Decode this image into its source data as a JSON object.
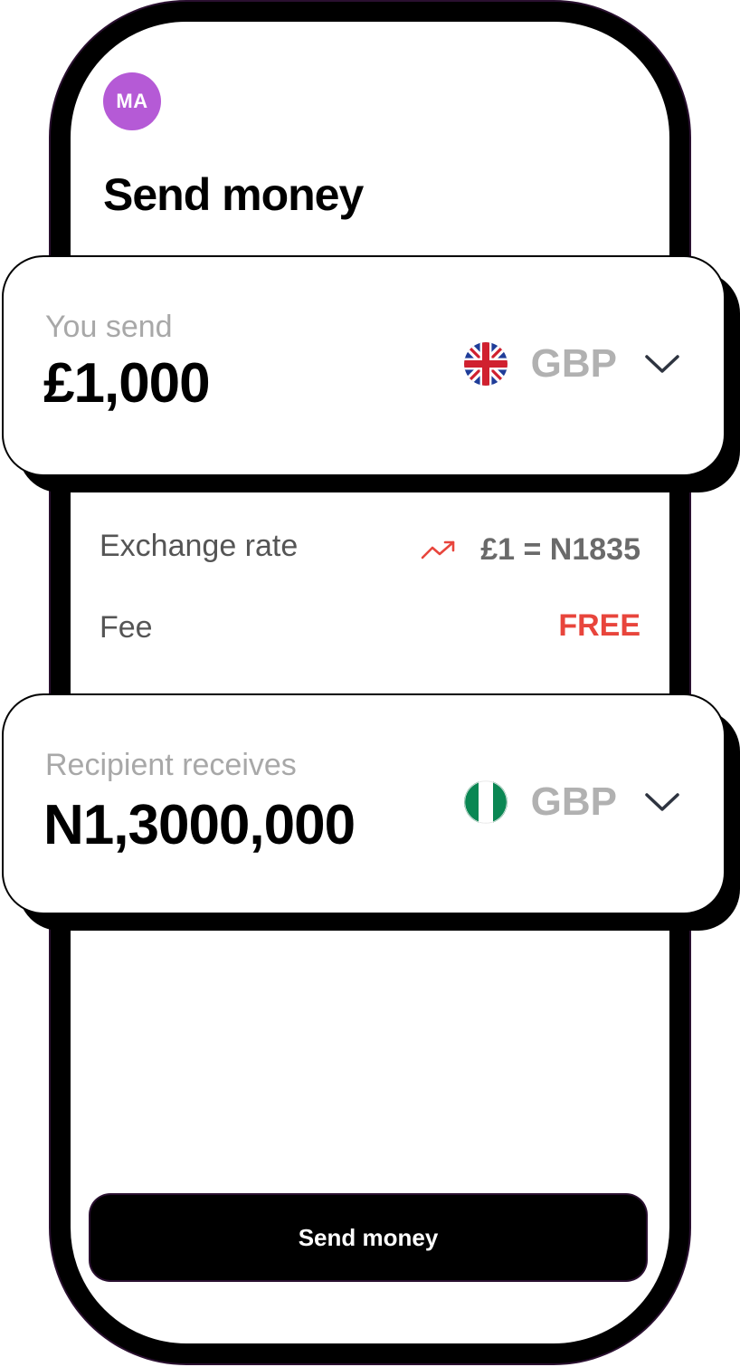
{
  "header": {
    "avatar_initials": "MA",
    "title": "Send money"
  },
  "send_card": {
    "label": "You send",
    "amount": "£1,000",
    "currency": "GBP",
    "flag_icon": "uk-flag-icon"
  },
  "exchange": {
    "rate_label": "Exchange rate",
    "rate_value": "£1 = N1835",
    "trend_icon": "trending-up-icon",
    "fee_label": "Fee",
    "fee_value": "FREE"
  },
  "receive_card": {
    "label": "Recipient receives",
    "amount": "N1,3000,000",
    "currency": "GBP",
    "flag_icon": "nigeria-flag-icon"
  },
  "action": {
    "send_label": "Send money"
  },
  "colors": {
    "avatar": "#b55ad6",
    "fee_highlight": "#e8453c",
    "muted_text": "#a8a8a8",
    "button_bg": "#000000"
  }
}
